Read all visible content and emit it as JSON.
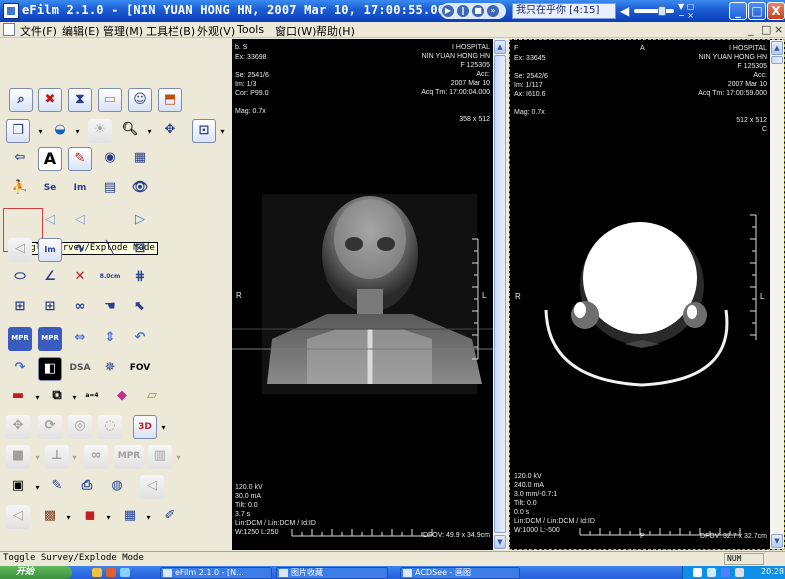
{
  "window": {
    "title": "eFilm 2.1.0 - [NIN YUAN HONG HN, 2007 Mar 10, 17:00:55.000  /  ]",
    "player_song": "我只在乎你 [4:15]",
    "min_label": "_",
    "max_label": "□",
    "close_label": "X"
  },
  "menu": {
    "items": [
      "文件(F)",
      "编辑(E)",
      "管理(M)",
      "工具栏(B)",
      "外观(V)",
      "Tools",
      "窗口(W)",
      "帮助(H)"
    ],
    "mdi_controls": [
      "_",
      "□",
      "×"
    ]
  },
  "toolbar": {
    "tooltip": "Toggle Survey/Explode Mode",
    "buttons": {
      "se": "Se",
      "im": "Im",
      "dsa": "DSA",
      "fov": "FOV",
      "mpr": "MPR",
      "mpr2": "MPR",
      "mpr3": "MPR",
      "text_tool": "A",
      "measure_cm": "8.0cm",
      "q4": "a=4",
      "threed": "3D"
    }
  },
  "viewport_left": {
    "tl": [
      "Ex: 33698",
      "",
      "Se: 2541/6",
      "Im: 1/3",
      "Cor: P99.0",
      "",
      "Mag: 0.7x"
    ],
    "tl_top": "b.         S",
    "tr": [
      "I HOSPITAL",
      "NIN YUAN HONG HN",
      "F 125305",
      "Acc:",
      "2007 Mar 10",
      "Acq Tm: 17:00:04.000",
      "",
      "",
      "358 x 512"
    ],
    "bl": [
      "120.0 kV",
      "30.0 mA",
      "Tilt: 0.0",
      "3.7 s",
      "Lin:DCM / Lin:DCM / Id:ID",
      "W:1250  L:250"
    ],
    "br": "DFOV: 49.9 x 34.9cm",
    "side_r": "R",
    "side_l": "L",
    "top_s": "S"
  },
  "viewport_right": {
    "tl_top": "F",
    "tl": [
      "Ex: 33645",
      "",
      "Se: 2542/6",
      "Im: 1/117",
      "Ax: I610.6",
      "",
      "Mag: 0.7x"
    ],
    "tr": [
      "I HOSPITAL",
      "NIN YUAN HONG HN",
      "F 125305",
      "Acc:",
      "2007 Mar 10",
      "Acq Tm: 17:00:59.000",
      "",
      "",
      "512 x 512"
    ],
    "tr_c": "C",
    "top_a": "A",
    "bl": [
      "120.0 kV",
      "240.0 mA",
      "3.0 mm/-0.7:1",
      "Tilt: 0.0",
      "0.0 s",
      "Lin:DCM / Lin:DCM / Id:ID",
      "W:1000  L:-500"
    ],
    "br": "DFOV: 32.7 x 32.7cm",
    "bottom_p": "P",
    "side_r": "R",
    "side_l": "L"
  },
  "status": {
    "text": "Toggle Survey/Explode Mode",
    "num": "NUM"
  },
  "taskbar": {
    "start": "开始",
    "tasks": [
      "eFilm 2.1.0 - [N...",
      "图片收藏",
      "ACDSee - 画图"
    ],
    "clock": "20:28"
  },
  "colors": {
    "title_bar": "#1e5fd6",
    "viewport_bg": "#000000",
    "active_border": "#c6c61a",
    "tooltip_bg": "#ffffe1"
  }
}
